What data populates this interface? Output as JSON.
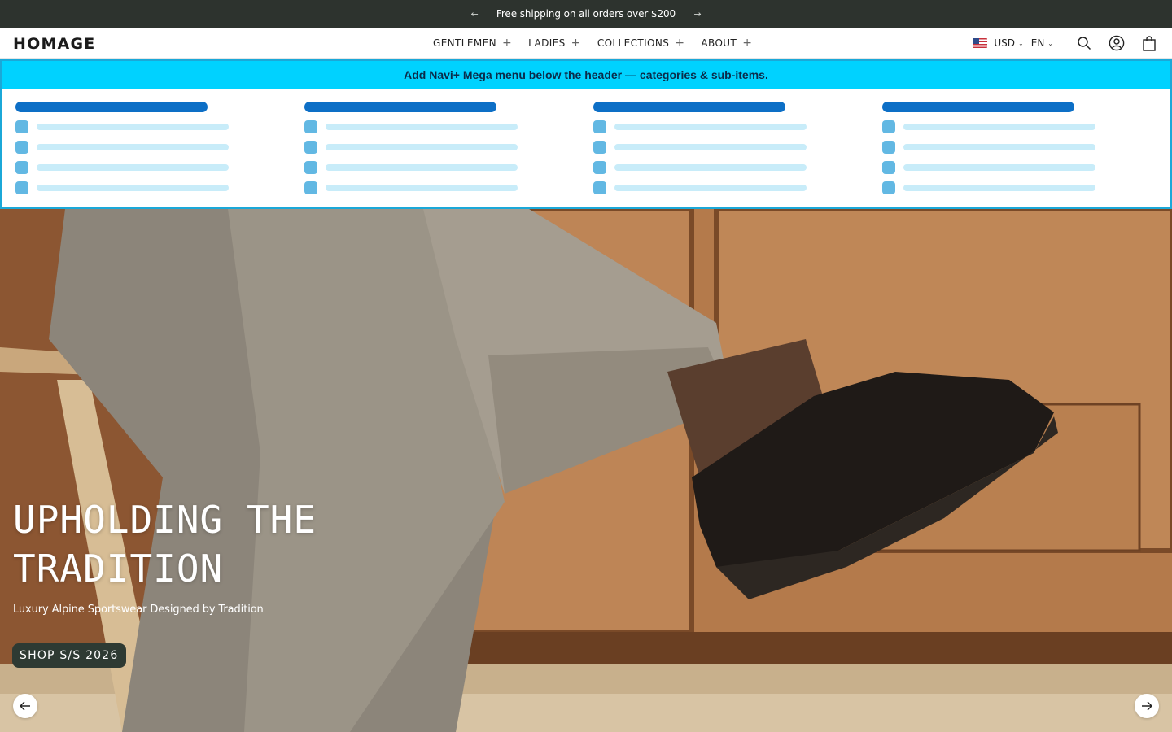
{
  "announcement": {
    "text": "Free shipping on all orders over $200",
    "prev_icon": "arrow-left-icon",
    "next_icon": "arrow-right-icon"
  },
  "header": {
    "logo": "HOMAGE",
    "nav": [
      {
        "label": "GENTLEMEN",
        "icon": "plus-icon"
      },
      {
        "label": "LADIES",
        "icon": "plus-icon"
      },
      {
        "label": "COLLECTIONS",
        "icon": "plus-icon"
      },
      {
        "label": "ABOUT",
        "icon": "plus-icon"
      }
    ],
    "currency": "USD",
    "language": "EN",
    "icons": [
      "us-flag-icon",
      "search-icon",
      "account-icon",
      "cart-icon"
    ]
  },
  "mega_menu": {
    "banner": "Add Navi+ Mega menu below the header — categories & sub-items.",
    "columns": 4,
    "rows_per_column": 4,
    "colors": {
      "banner": "#00d2ff",
      "border": "#1ba8d8",
      "heading": "#0d6fc6",
      "item_icon": "#62b8e3",
      "item_bar": "#c8ecf9"
    }
  },
  "hero": {
    "title_line1": "UPHOLDING THE",
    "title_line2": "TRADITION",
    "subtitle": "Luxury Alpine Sportswear Designed by Tradition",
    "cta": "SHOP S/S 2026",
    "prev_icon": "arrow-left-icon",
    "next_icon": "arrow-right-icon"
  },
  "colors": {
    "announcement_bg": "#2d332e",
    "button_bg": "#2e3a33"
  }
}
